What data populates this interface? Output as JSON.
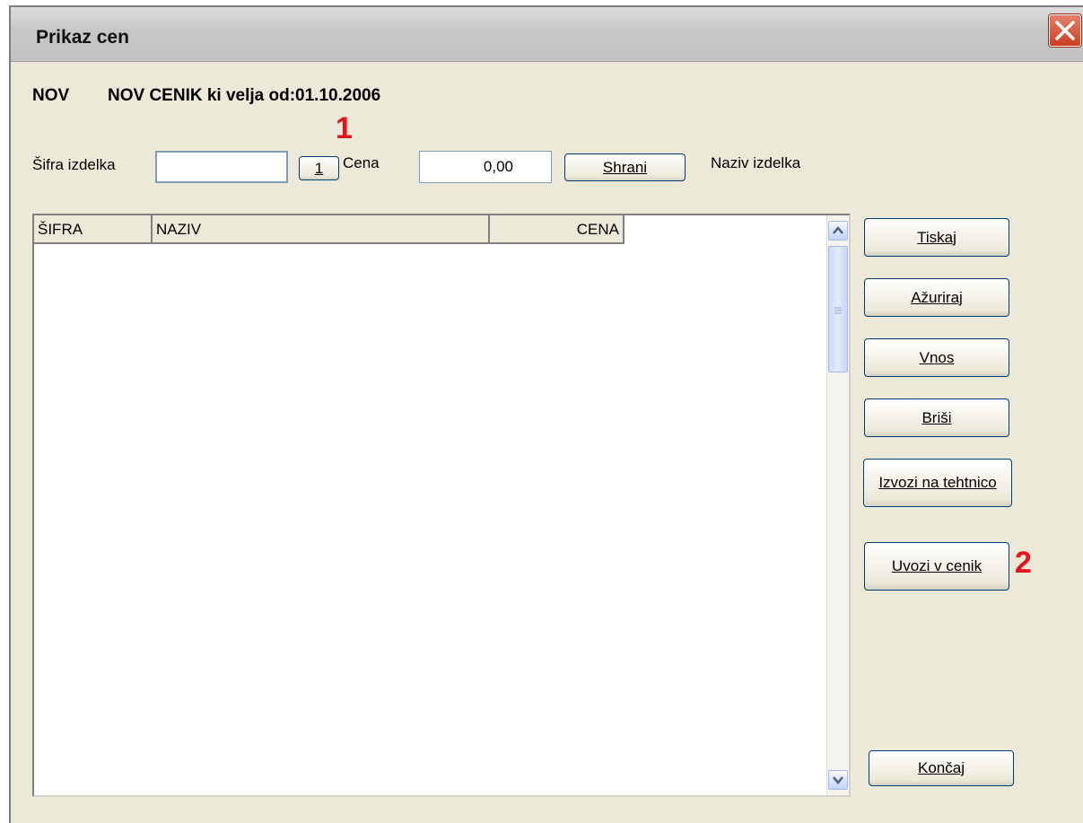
{
  "window": {
    "title": "Prikaz cen"
  },
  "header": {
    "code": "NOV",
    "description": "NOV CENIK ki velja od:01.10.2006"
  },
  "form": {
    "sifra_label": "Šifra izdelka",
    "sifra_value": "",
    "lookup_button": "1",
    "cena_label": "Cena",
    "cena_value": "0,00",
    "save_button": "Shrani",
    "naziv_label": "Naziv izdelka"
  },
  "table": {
    "columns": [
      "ŠIFRA",
      "NAZIV",
      "CENA"
    ],
    "rows": []
  },
  "buttons": {
    "print": "Tiskaj",
    "update": "Ažuriraj",
    "entry": "Vnos",
    "delete": "Briši",
    "export": "Izvozi na tehtnico",
    "import": "Uvozi v cenik",
    "finish": "Končaj"
  },
  "annotations": {
    "first": "1",
    "second": "2"
  },
  "colors": {
    "annotation": "#e8121c",
    "window_bg": "#ece9d8",
    "title_bg": "#c8c8c8"
  }
}
